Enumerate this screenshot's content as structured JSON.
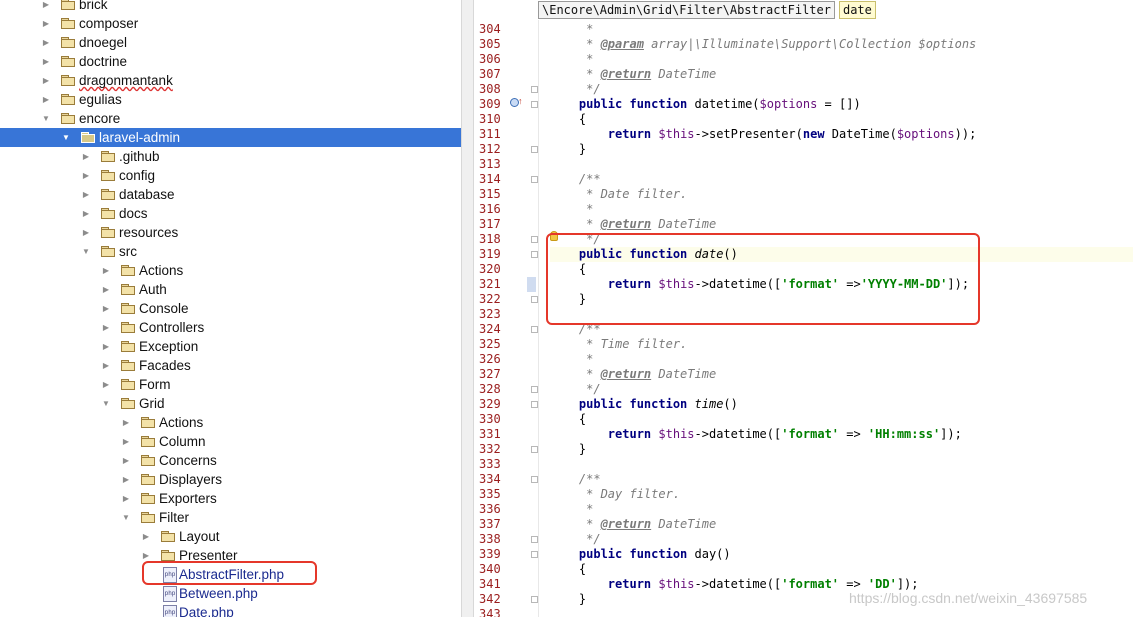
{
  "tree": {
    "items": [
      {
        "label": "brick",
        "kind": "folder",
        "depth": 0,
        "expanded": false
      },
      {
        "label": "composer",
        "kind": "folder",
        "depth": 0,
        "expanded": false
      },
      {
        "label": "dnoegel",
        "kind": "folder",
        "depth": 0,
        "expanded": false
      },
      {
        "label": "doctrine",
        "kind": "folder",
        "depth": 0,
        "expanded": false
      },
      {
        "label": "dragonmantank",
        "kind": "folder",
        "depth": 0,
        "expanded": false,
        "squiggle": true
      },
      {
        "label": "egulias",
        "kind": "folder",
        "depth": 0,
        "expanded": false
      },
      {
        "label": "encore",
        "kind": "folder",
        "depth": 0,
        "expanded": true
      },
      {
        "label": "laravel-admin",
        "kind": "folder",
        "depth": 1,
        "expanded": true,
        "selected": true
      },
      {
        "label": ".github",
        "kind": "folder",
        "depth": 2,
        "expanded": false
      },
      {
        "label": "config",
        "kind": "folder",
        "depth": 2,
        "expanded": false
      },
      {
        "label": "database",
        "kind": "folder",
        "depth": 2,
        "expanded": false
      },
      {
        "label": "docs",
        "kind": "folder",
        "depth": 2,
        "expanded": false
      },
      {
        "label": "resources",
        "kind": "folder",
        "depth": 2,
        "expanded": false
      },
      {
        "label": "src",
        "kind": "folder",
        "depth": 2,
        "expanded": true
      },
      {
        "label": "Actions",
        "kind": "folder",
        "depth": 3,
        "expanded": false
      },
      {
        "label": "Auth",
        "kind": "folder",
        "depth": 3,
        "expanded": false
      },
      {
        "label": "Console",
        "kind": "folder",
        "depth": 3,
        "expanded": false
      },
      {
        "label": "Controllers",
        "kind": "folder",
        "depth": 3,
        "expanded": false
      },
      {
        "label": "Exception",
        "kind": "folder",
        "depth": 3,
        "expanded": false
      },
      {
        "label": "Facades",
        "kind": "folder",
        "depth": 3,
        "expanded": false
      },
      {
        "label": "Form",
        "kind": "folder",
        "depth": 3,
        "expanded": false
      },
      {
        "label": "Grid",
        "kind": "folder",
        "depth": 3,
        "expanded": true
      },
      {
        "label": "Actions",
        "kind": "folder",
        "depth": 4,
        "expanded": false
      },
      {
        "label": "Column",
        "kind": "folder",
        "depth": 4,
        "expanded": false
      },
      {
        "label": "Concerns",
        "kind": "folder",
        "depth": 4,
        "expanded": false
      },
      {
        "label": "Displayers",
        "kind": "folder",
        "depth": 4,
        "expanded": false
      },
      {
        "label": "Exporters",
        "kind": "folder",
        "depth": 4,
        "expanded": false
      },
      {
        "label": "Filter",
        "kind": "folder",
        "depth": 4,
        "expanded": true
      },
      {
        "label": "Layout",
        "kind": "folder",
        "depth": 5,
        "expanded": false
      },
      {
        "label": "Presenter",
        "kind": "folder",
        "depth": 5,
        "expanded": false
      },
      {
        "label": "AbstractFilter.php",
        "kind": "php",
        "depth": 5,
        "highlighted": true
      },
      {
        "label": "Between.php",
        "kind": "php",
        "depth": 5
      },
      {
        "label": "Date.php",
        "kind": "php",
        "depth": 5
      }
    ]
  },
  "breadcrumb": {
    "path": "\\Encore\\Admin\\Grid\\Filter\\AbstractFilter",
    "method": "date"
  },
  "editor": {
    "lines": [
      {
        "n": "304",
        "tokens": [
          [
            "cm",
            "     *"
          ]
        ]
      },
      {
        "n": "305",
        "tokens": [
          [
            "cm",
            "     * "
          ],
          [
            "tag",
            "@param"
          ],
          [
            "cm",
            " array|\\Illuminate\\Support\\Collection $options"
          ]
        ]
      },
      {
        "n": "306",
        "tokens": [
          [
            "cm",
            "     *"
          ]
        ]
      },
      {
        "n": "307",
        "tokens": [
          [
            "cm",
            "     * "
          ],
          [
            "tag",
            "@return"
          ],
          [
            "cm",
            " DateTime"
          ]
        ]
      },
      {
        "n": "308",
        "tokens": [
          [
            "cm",
            "     */"
          ]
        ],
        "fold": true
      },
      {
        "n": "309",
        "tokens": [
          [
            "p",
            "    "
          ],
          [
            "kw",
            "public function"
          ],
          [
            "p",
            " datetime("
          ],
          [
            "var",
            "$options"
          ],
          [
            "p",
            " = [])"
          ]
        ],
        "fold": true
      },
      {
        "n": "310",
        "tokens": [
          [
            "p",
            "    {"
          ]
        ]
      },
      {
        "n": "311",
        "tokens": [
          [
            "p",
            "        "
          ],
          [
            "kw",
            "return"
          ],
          [
            "p",
            " "
          ],
          [
            "var",
            "$this"
          ],
          [
            "p",
            "->setPresenter("
          ],
          [
            "kw",
            "new"
          ],
          [
            "p",
            " DateTime("
          ],
          [
            "var",
            "$options"
          ],
          [
            "p",
            "));"
          ]
        ]
      },
      {
        "n": "312",
        "tokens": [
          [
            "p",
            "    }"
          ]
        ],
        "fold": true
      },
      {
        "n": "313",
        "tokens": [
          [
            "p",
            ""
          ]
        ]
      },
      {
        "n": "314",
        "tokens": [
          [
            "cm",
            "    /**"
          ]
        ],
        "fold": true
      },
      {
        "n": "315",
        "tokens": [
          [
            "cm",
            "     * Date filter."
          ]
        ]
      },
      {
        "n": "316",
        "tokens": [
          [
            "cm",
            "     *"
          ]
        ]
      },
      {
        "n": "317",
        "tokens": [
          [
            "cm",
            "     * "
          ],
          [
            "tag",
            "@return"
          ],
          [
            "cm",
            " DateTime"
          ]
        ]
      },
      {
        "n": "318",
        "tokens": [
          [
            "cm",
            "     */"
          ]
        ],
        "fold": true
      },
      {
        "n": "319",
        "tokens": [
          [
            "p",
            "    "
          ],
          [
            "kw",
            "public function"
          ],
          [
            "p",
            " "
          ],
          [
            "fi",
            "date"
          ],
          [
            "p",
            "()"
          ]
        ],
        "fold": true,
        "current": true
      },
      {
        "n": "320",
        "tokens": [
          [
            "p",
            "    {"
          ]
        ]
      },
      {
        "n": "321",
        "tokens": [
          [
            "p",
            "        "
          ],
          [
            "kw",
            "return"
          ],
          [
            "p",
            " "
          ],
          [
            "var",
            "$this"
          ],
          [
            "p",
            "->datetime(["
          ],
          [
            "str",
            "'format'"
          ],
          [
            "p",
            " =>"
          ],
          [
            "str",
            "'YYYY-MM-DD'"
          ],
          [
            "p",
            "]);"
          ]
        ]
      },
      {
        "n": "322",
        "tokens": [
          [
            "p",
            "    }"
          ]
        ],
        "fold": true
      },
      {
        "n": "323",
        "tokens": [
          [
            "p",
            ""
          ]
        ]
      },
      {
        "n": "324",
        "tokens": [
          [
            "cm",
            "    /**"
          ]
        ],
        "fold": true
      },
      {
        "n": "325",
        "tokens": [
          [
            "cm",
            "     * Time filter."
          ]
        ]
      },
      {
        "n": "326",
        "tokens": [
          [
            "cm",
            "     *"
          ]
        ]
      },
      {
        "n": "327",
        "tokens": [
          [
            "cm",
            "     * "
          ],
          [
            "tag",
            "@return"
          ],
          [
            "cm",
            " DateTime"
          ]
        ]
      },
      {
        "n": "328",
        "tokens": [
          [
            "cm",
            "     */"
          ]
        ],
        "fold": true
      },
      {
        "n": "329",
        "tokens": [
          [
            "p",
            "    "
          ],
          [
            "kw",
            "public function"
          ],
          [
            "p",
            " "
          ],
          [
            "fi",
            "time"
          ],
          [
            "p",
            "()"
          ]
        ],
        "fold": true
      },
      {
        "n": "330",
        "tokens": [
          [
            "p",
            "    {"
          ]
        ]
      },
      {
        "n": "331",
        "tokens": [
          [
            "p",
            "        "
          ],
          [
            "kw",
            "return"
          ],
          [
            "p",
            " "
          ],
          [
            "var",
            "$this"
          ],
          [
            "p",
            "->datetime(["
          ],
          [
            "str",
            "'format'"
          ],
          [
            "p",
            " => "
          ],
          [
            "str",
            "'HH:mm:ss'"
          ],
          [
            "p",
            "]);"
          ]
        ]
      },
      {
        "n": "332",
        "tokens": [
          [
            "p",
            "    }"
          ]
        ],
        "fold": true
      },
      {
        "n": "333",
        "tokens": [
          [
            "p",
            ""
          ]
        ]
      },
      {
        "n": "334",
        "tokens": [
          [
            "cm",
            "    /**"
          ]
        ],
        "fold": true
      },
      {
        "n": "335",
        "tokens": [
          [
            "cm",
            "     * Day filter."
          ]
        ]
      },
      {
        "n": "336",
        "tokens": [
          [
            "cm",
            "     *"
          ]
        ]
      },
      {
        "n": "337",
        "tokens": [
          [
            "cm",
            "     * "
          ],
          [
            "tag",
            "@return"
          ],
          [
            "cm",
            " DateTime"
          ]
        ]
      },
      {
        "n": "338",
        "tokens": [
          [
            "cm",
            "     */"
          ]
        ],
        "fold": true
      },
      {
        "n": "339",
        "tokens": [
          [
            "p",
            "    "
          ],
          [
            "kw",
            "public function"
          ],
          [
            "p",
            " day()"
          ]
        ],
        "fold": true
      },
      {
        "n": "340",
        "tokens": [
          [
            "p",
            "    {"
          ]
        ]
      },
      {
        "n": "341",
        "tokens": [
          [
            "p",
            "        "
          ],
          [
            "kw",
            "return"
          ],
          [
            "p",
            " "
          ],
          [
            "var",
            "$this"
          ],
          [
            "p",
            "->datetime(["
          ],
          [
            "str",
            "'format'"
          ],
          [
            "p",
            " => "
          ],
          [
            "str",
            "'DD'"
          ],
          [
            "p",
            "]);"
          ]
        ]
      },
      {
        "n": "342",
        "tokens": [
          [
            "p",
            "    }"
          ]
        ],
        "fold": true
      },
      {
        "n": "343",
        "tokens": [
          [
            "p",
            ""
          ]
        ]
      }
    ]
  },
  "watermark": "https://blog.csdn.net/weixin_43697585",
  "colors": {
    "selection": "#3875d7",
    "annotation_box": "#e5372a",
    "keyword": "#000080",
    "string": "#008000",
    "line_number": "#9a1d1d"
  }
}
